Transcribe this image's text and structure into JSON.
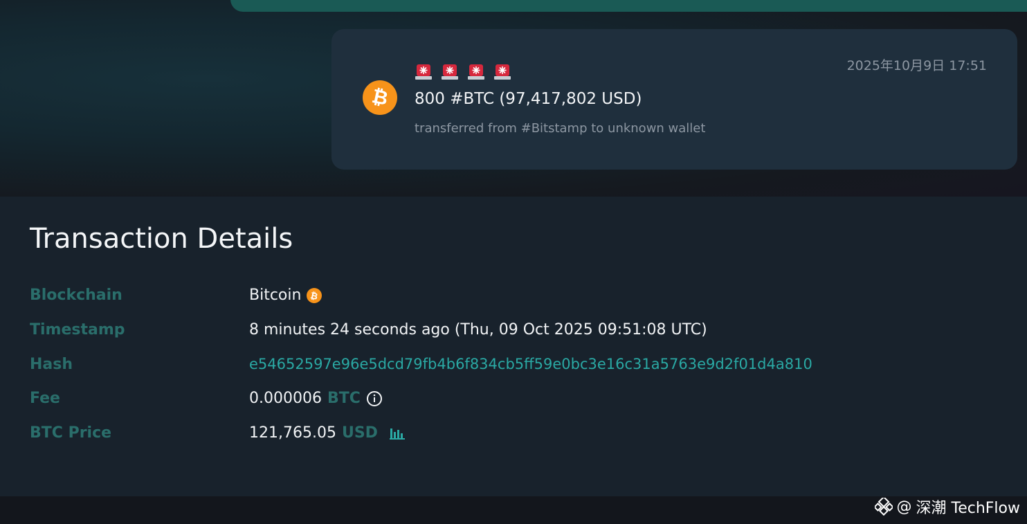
{
  "alert": {
    "timestamp": "2025年10月9日 17:51",
    "amount": "800 #BTC (97,417,802 USD)",
    "description": "transferred from #Bitstamp to unknown wallet",
    "siren_count": 4,
    "coin_icon": "bitcoin-icon",
    "siren_icon": "rotating-light-icon"
  },
  "details": {
    "title": "Transaction Details",
    "blockchain": {
      "label": "Blockchain",
      "value": "Bitcoin"
    },
    "timestamp": {
      "label": "Timestamp",
      "value": "8 minutes 24 seconds ago (Thu, 09 Oct 2025 09:51:08 UTC)"
    },
    "hash": {
      "label": "Hash",
      "value": "e54652597e96e5dcd79fb4b6f834cb5ff59e0bc3e16c31a5763e9d2f01d4a810"
    },
    "fee": {
      "label": "Fee",
      "value": "0.000006",
      "unit": "BTC"
    },
    "price": {
      "label": "BTC Price",
      "value": "121,765.05",
      "unit": "USD"
    }
  },
  "watermark": {
    "at": "@",
    "text": "深潮 TechFlow"
  },
  "colors": {
    "accent_teal": "#2aa9a4",
    "label_teal": "#2a6e6b",
    "bitcoin_orange": "#f7931a",
    "card_bg": "#1f2f3d"
  }
}
